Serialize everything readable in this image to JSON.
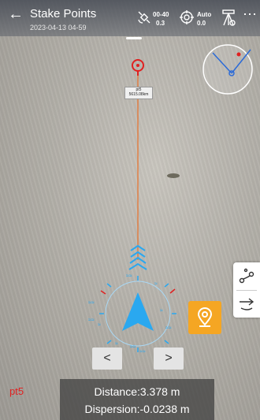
{
  "header": {
    "title": "Stake Points",
    "subtitle": "2023-04-13 04-59",
    "satellite": {
      "top": "00-40",
      "bottom": "0.3"
    },
    "solution": {
      "top": "Auto",
      "bottom": "0.0"
    }
  },
  "target_label": {
    "line1": "pt5",
    "line2": "5615.08km"
  },
  "point_name": "pt5",
  "info": {
    "distance": "Distance:3.378 m",
    "dispersion": "Dispersion:-0.0238 m"
  },
  "nav": {
    "prev": "<",
    "next": ">"
  },
  "colors": {
    "accent": "#f5a623",
    "guide": "#e8702a",
    "arrow": "#2aa8f0",
    "target": "#e02020"
  },
  "icons": [
    "back-icon",
    "satellite-icon",
    "target-mode-icon",
    "tripod-icon",
    "more-icon",
    "compass-icon",
    "route-icon",
    "arrow-switch-icon",
    "location-pin-icon"
  ]
}
